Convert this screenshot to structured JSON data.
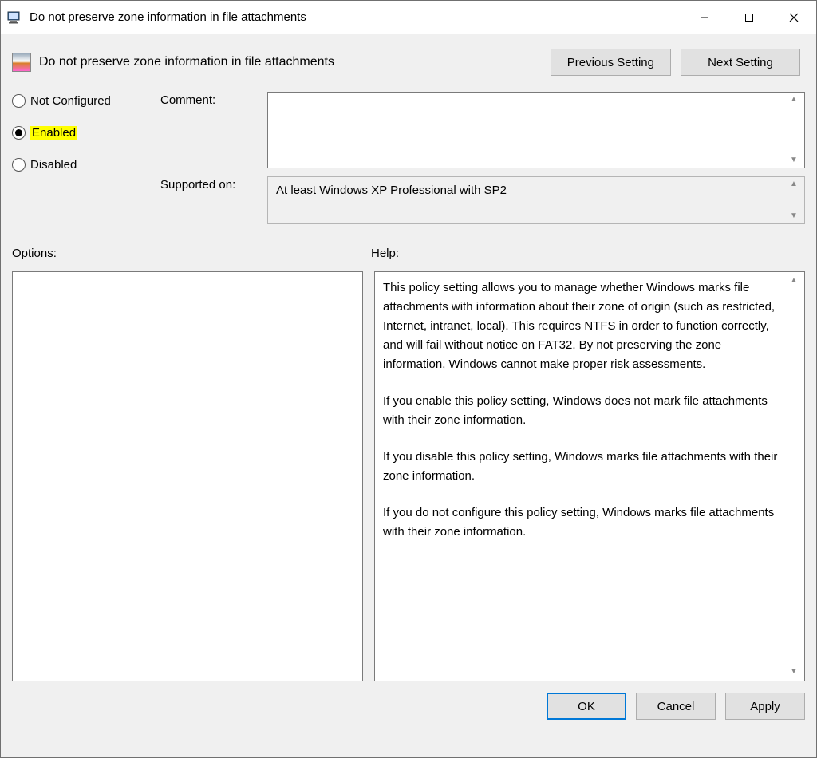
{
  "window": {
    "title": "Do not preserve zone information in file attachments"
  },
  "header": {
    "policy_name": "Do not preserve zone information in file attachments",
    "prev_btn": "Previous Setting",
    "next_btn": "Next Setting"
  },
  "state": {
    "not_configured": "Not Configured",
    "enabled": "Enabled",
    "disabled": "Disabled",
    "selected": "enabled"
  },
  "fields": {
    "comment_label": "Comment:",
    "comment_value": "",
    "supported_label": "Supported on:",
    "supported_value": "At least Windows XP Professional with SP2"
  },
  "labels": {
    "options": "Options:",
    "help": "Help:"
  },
  "help": {
    "p1": "This policy setting allows you to manage whether Windows marks file attachments with information about their zone of origin (such as restricted, Internet, intranet, local). This requires NTFS in order to function correctly, and will fail without notice on FAT32. By not preserving the zone information, Windows cannot make proper risk assessments.",
    "p2": "If you enable this policy setting, Windows does not mark file attachments with their zone information.",
    "p3": "If you disable this policy setting, Windows marks file attachments with their zone information.",
    "p4": "If you do not configure this policy setting, Windows marks file attachments with their zone information."
  },
  "footer": {
    "ok": "OK",
    "cancel": "Cancel",
    "apply": "Apply"
  }
}
